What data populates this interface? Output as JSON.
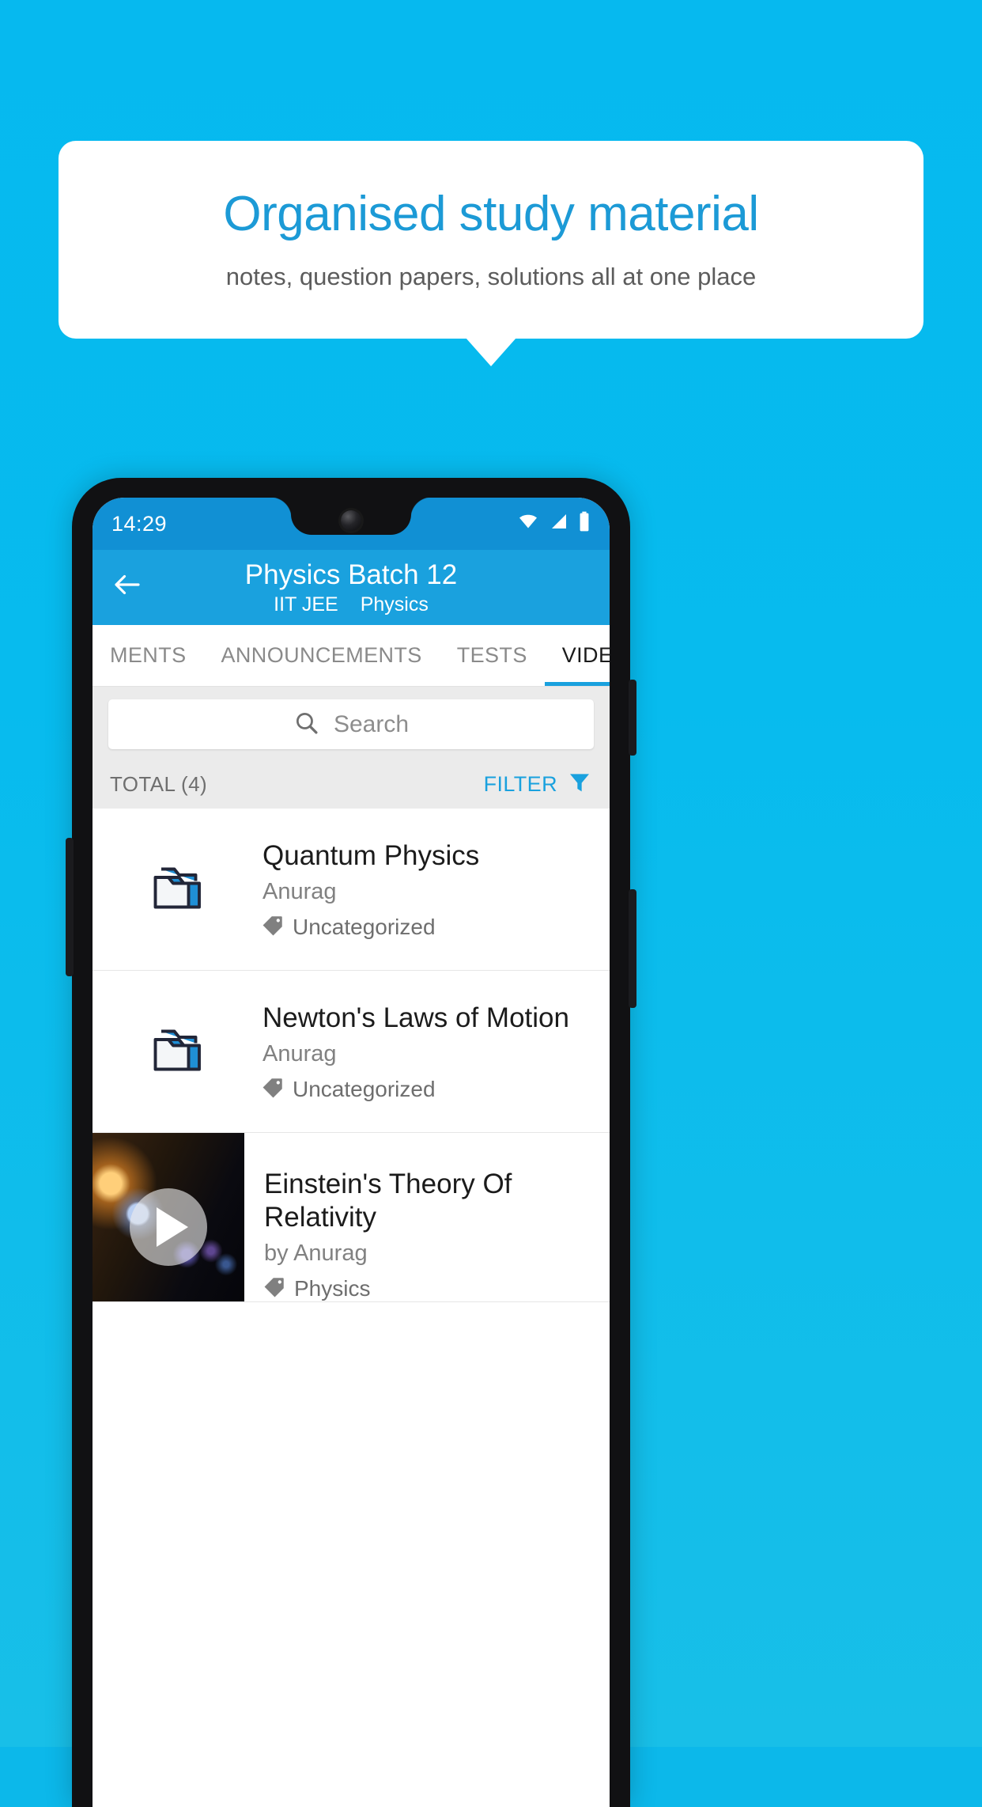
{
  "promo": {
    "title": "Organised study material",
    "subtitle": "notes, question papers, solutions all at one place",
    "accent_color": "#1c9ad6",
    "background_color": "#06b9ef"
  },
  "phone": {
    "status_bar": {
      "time": "14:29",
      "icons": [
        "wifi-icon",
        "signal-icon",
        "battery-icon"
      ],
      "background_color": "#1190d4"
    },
    "app_bar": {
      "back_icon": "back-arrow-icon",
      "title": "Physics Batch 12",
      "exam": "IIT JEE",
      "subject": "Physics",
      "background_color": "#1aa1de"
    },
    "tabs": [
      {
        "label": "MENTS",
        "active": false
      },
      {
        "label": "ANNOUNCEMENTS",
        "active": false
      },
      {
        "label": "TESTS",
        "active": false
      },
      {
        "label": "VIDEOS",
        "active": true
      }
    ],
    "search": {
      "icon": "search-icon",
      "placeholder": "Search",
      "value": ""
    },
    "meta": {
      "total_label": "TOTAL (4)",
      "filter_label": "FILTER",
      "filter_icon": "filter-funnel-icon"
    },
    "list": [
      {
        "type": "folder",
        "icon": "folder-icon",
        "title": "Quantum Physics",
        "author": "Anurag",
        "tag_icon": "tag-icon",
        "tag": "Uncategorized"
      },
      {
        "type": "folder",
        "icon": "folder-icon",
        "title": "Newton's Laws of Motion",
        "author": "Anurag",
        "tag_icon": "tag-icon",
        "tag": "Uncategorized"
      },
      {
        "type": "video",
        "icon": "play-icon",
        "title": "Einstein's Theory Of Relativity",
        "author": "by Anurag",
        "tag_icon": "tag-icon",
        "tag": "Physics"
      }
    ]
  }
}
